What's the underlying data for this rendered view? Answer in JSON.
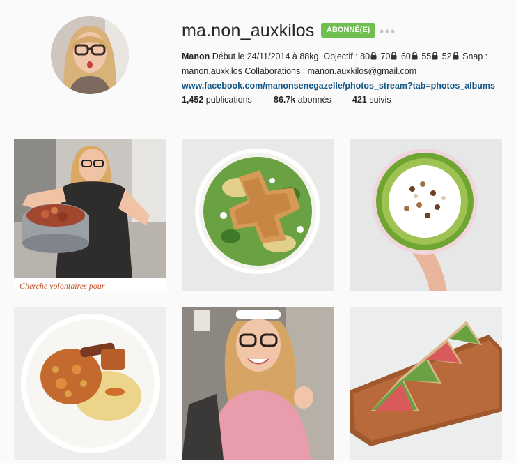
{
  "profile": {
    "username": "ma.non_auxkilos",
    "follow_label": "ABONNÉ(E)",
    "more_icon": "ellipsis-icon",
    "bio": {
      "name": "Manon",
      "line1_rest": " Début le 24/11/2014 à 88kg. Objectif : ",
      "goals": [
        "80",
        "70",
        "60",
        "55",
        "52"
      ],
      "snap_label": "Snap :",
      "line2": "manon.auxkilos Collaborations : manon.auxkilos@gmail.com",
      "link": "www.facebook.com/manonsenegazelle/photos_stream?tab=photos_albums"
    },
    "stats": {
      "posts_count": "1,452",
      "posts_label": " publications",
      "followers_count": "86.7k",
      "followers_label": " abonnés",
      "following_count": "421",
      "following_label": " suivis"
    }
  },
  "posts": [
    {
      "caption": "Cherche volontaires pour"
    },
    {
      "caption": ""
    },
    {
      "caption": ""
    },
    {
      "caption": ""
    },
    {
      "caption": ""
    },
    {
      "caption": ""
    }
  ],
  "colors": {
    "follow_green": "#70c050",
    "link_blue": "#125688",
    "background": "#fafafa"
  }
}
